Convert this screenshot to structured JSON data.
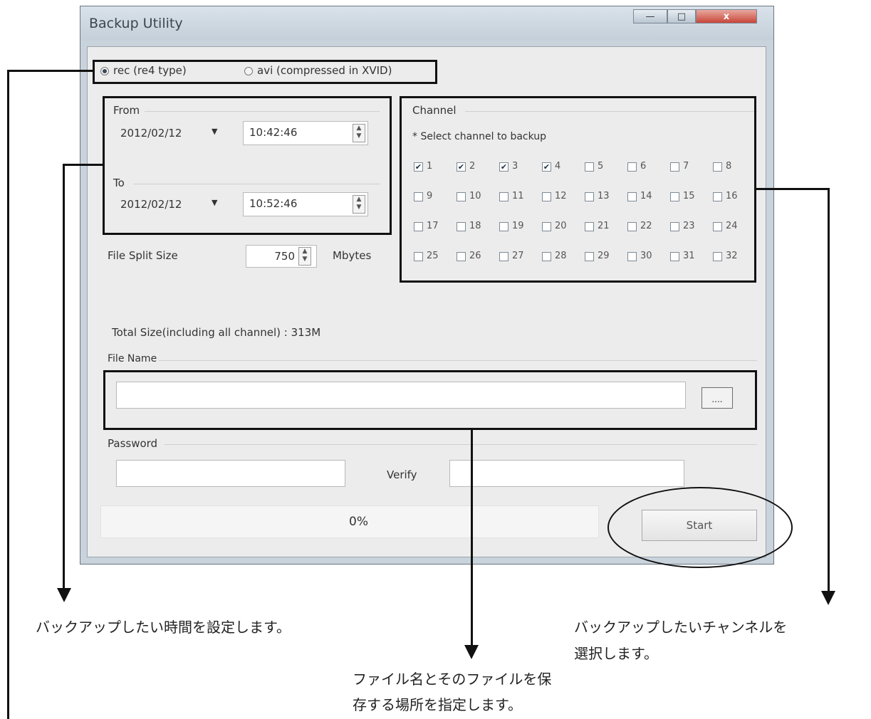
{
  "window": {
    "title": "Backup Utility",
    "close_glyph": "x"
  },
  "format": {
    "options": [
      {
        "label": "rec (re4 type)",
        "selected": true
      },
      {
        "label": "avi (compressed in XVID)",
        "selected": false
      }
    ]
  },
  "from": {
    "label": "From",
    "date": "2012/02/12",
    "time": "10:42:46"
  },
  "to": {
    "label": "To",
    "date": "2012/02/12",
    "time": "10:52:46"
  },
  "split": {
    "label": "File Split Size",
    "value": "750",
    "unit": "Mbytes"
  },
  "channel": {
    "label": "Channel",
    "hint": "* Select channel to backup",
    "items": [
      {
        "n": "1",
        "on": true
      },
      {
        "n": "2",
        "on": true
      },
      {
        "n": "3",
        "on": true
      },
      {
        "n": "4",
        "on": true
      },
      {
        "n": "5",
        "on": false
      },
      {
        "n": "6",
        "on": false
      },
      {
        "n": "7",
        "on": false
      },
      {
        "n": "8",
        "on": false
      },
      {
        "n": "9",
        "on": false
      },
      {
        "n": "10",
        "on": false
      },
      {
        "n": "11",
        "on": false
      },
      {
        "n": "12",
        "on": false
      },
      {
        "n": "13",
        "on": false
      },
      {
        "n": "14",
        "on": false
      },
      {
        "n": "15",
        "on": false
      },
      {
        "n": "16",
        "on": false
      },
      {
        "n": "17",
        "on": false
      },
      {
        "n": "18",
        "on": false
      },
      {
        "n": "19",
        "on": false
      },
      {
        "n": "20",
        "on": false
      },
      {
        "n": "21",
        "on": false
      },
      {
        "n": "22",
        "on": false
      },
      {
        "n": "23",
        "on": false
      },
      {
        "n": "24",
        "on": false
      },
      {
        "n": "25",
        "on": false
      },
      {
        "n": "26",
        "on": false
      },
      {
        "n": "27",
        "on": false
      },
      {
        "n": "28",
        "on": false
      },
      {
        "n": "29",
        "on": false
      },
      {
        "n": "30",
        "on": false
      },
      {
        "n": "31",
        "on": false
      },
      {
        "n": "32",
        "on": false
      }
    ]
  },
  "total_size": "Total Size(including all channel) : 313M",
  "file_name": {
    "label": "File Name",
    "value": "",
    "browse": "...."
  },
  "password": {
    "label": "Password",
    "value": "",
    "verify_label": "Verify",
    "verify_value": ""
  },
  "progress": {
    "text": "0%",
    "fraction": 0
  },
  "start_label": "Start",
  "annotations": {
    "time": "バックアップしたい時間を設定します。",
    "channel_line1": "バックアップしたいチャンネルを",
    "channel_line2": "選択します。",
    "file_line1": "ファイル名とそのファイルを保",
    "file_line2": "存する場所を指定します。"
  }
}
